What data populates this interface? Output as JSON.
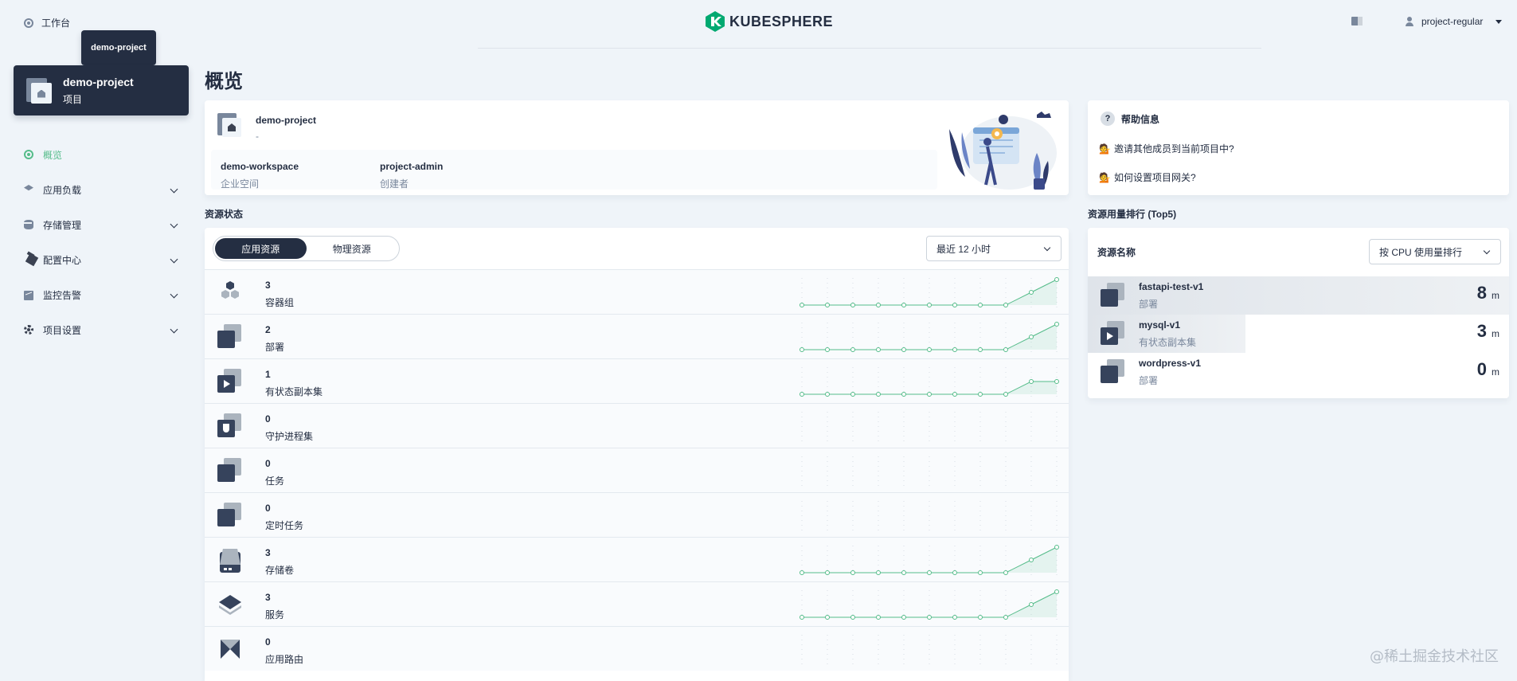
{
  "header": {
    "workbench_label": "工作台",
    "logo_text": "KUBESPHERE",
    "user_name": "project-regular"
  },
  "tooltip": "demo-project",
  "project": {
    "name": "demo-project",
    "type": "项目"
  },
  "nav": [
    {
      "label": "概览",
      "icon": "overview-icon",
      "active": true
    },
    {
      "label": "应用负载",
      "icon": "app-workload-icon"
    },
    {
      "label": "存储管理",
      "icon": "storage-icon"
    },
    {
      "label": "配置中心",
      "icon": "config-icon"
    },
    {
      "label": "监控告警",
      "icon": "monitor-icon"
    },
    {
      "label": "项目设置",
      "icon": "settings-icon"
    }
  ],
  "main": {
    "title": "概览",
    "info": {
      "project_name": "demo-project",
      "description": "-",
      "workspace": {
        "value": "demo-workspace",
        "key": "企业空间"
      },
      "creator": {
        "value": "project-admin",
        "key": "创建者"
      }
    },
    "help": {
      "title": "帮助信息",
      "links": [
        "邀请其他成员到当前项目中?",
        "如何设置项目网关?"
      ]
    },
    "resource_status_label": "资源状态",
    "tabs": [
      "应用资源",
      "物理资源"
    ],
    "time_range": "最近 12 小时",
    "resources": [
      {
        "count": "3",
        "label": "容器组",
        "icon": "pods-icon",
        "trend": [
          0,
          0,
          0,
          0,
          0,
          0,
          0,
          0,
          0,
          1,
          2
        ]
      },
      {
        "count": "2",
        "label": "部署",
        "icon": "deployment-icon",
        "trend": [
          0,
          0,
          0,
          0,
          0,
          0,
          0,
          0,
          0,
          1,
          2
        ]
      },
      {
        "count": "1",
        "label": "有状态副本集",
        "icon": "statefulset-icon",
        "trend": [
          0,
          0,
          0,
          0,
          0,
          0,
          0,
          0,
          0,
          1,
          1
        ]
      },
      {
        "count": "0",
        "label": "守护进程集",
        "icon": "daemonset-icon",
        "trend": []
      },
      {
        "count": "0",
        "label": "任务",
        "icon": "job-icon",
        "trend": []
      },
      {
        "count": "0",
        "label": "定时任务",
        "icon": "cronjob-icon",
        "trend": []
      },
      {
        "count": "3",
        "label": "存储卷",
        "icon": "volume-icon",
        "trend": [
          0,
          0,
          0,
          0,
          0,
          0,
          0,
          0,
          0,
          1,
          2
        ]
      },
      {
        "count": "3",
        "label": "服务",
        "icon": "service-icon",
        "trend": [
          0,
          0,
          0,
          0,
          0,
          0,
          0,
          0,
          0,
          1,
          2
        ]
      },
      {
        "count": "0",
        "label": "应用路由",
        "icon": "route-icon",
        "trend": []
      }
    ],
    "top5": {
      "label": "资源用量排行 (Top5)",
      "head": "资源名称",
      "sort": "按 CPU 使用量排行",
      "items": [
        {
          "name": "fastapi-test-v1",
          "type": "部署",
          "value": "8",
          "unit": "m",
          "share": 1.0,
          "icon": "deployment-icon"
        },
        {
          "name": "mysql-v1",
          "type": "有状态副本集",
          "value": "3",
          "unit": "m",
          "share": 0.375,
          "icon": "statefulset-icon"
        },
        {
          "name": "wordpress-v1",
          "type": "部署",
          "value": "0",
          "unit": "m",
          "share": 0,
          "icon": "deployment-icon"
        }
      ]
    }
  },
  "watermark": "@稀土掘金技术社区",
  "colors": {
    "accent": "#55bc8a",
    "dark": "#242e42",
    "muted": "#79879c",
    "background": "#eff4f9"
  }
}
